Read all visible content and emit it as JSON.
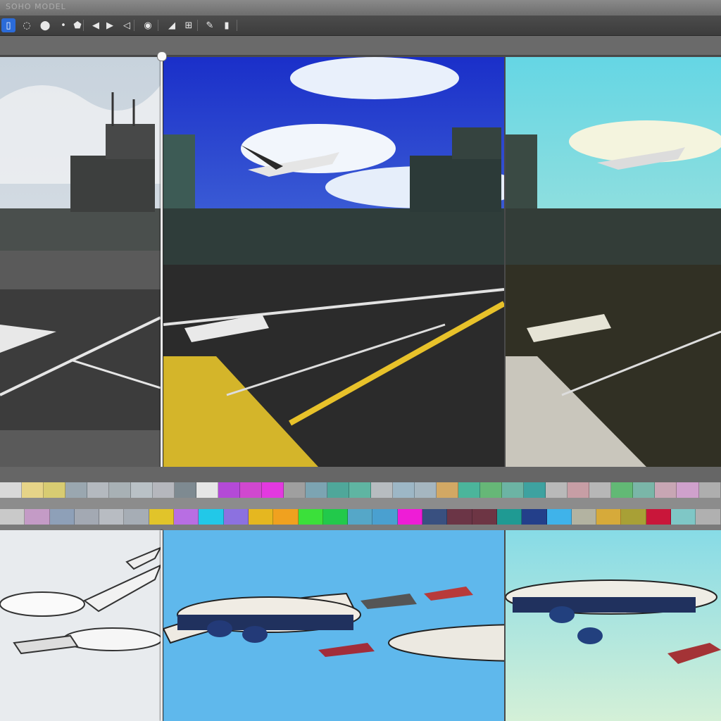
{
  "window": {
    "title": "SOHO MODEL"
  },
  "toolbar": {
    "tools": [
      {
        "name": "select-tool-icon",
        "glyph": "▯",
        "active": true
      },
      {
        "name": "lasso-tool-icon",
        "glyph": "◌",
        "active": false
      },
      {
        "name": "brush-tool-icon",
        "glyph": "⬤",
        "active": false
      },
      {
        "name": "dot-tool-icon",
        "glyph": "•",
        "active": false
      },
      {
        "name": "gem-tool-icon",
        "glyph": "⬟",
        "active": false
      },
      {
        "name": "arrow-left-icon",
        "glyph": "◀",
        "active": false
      },
      {
        "name": "arrow-right-icon",
        "glyph": "▶",
        "active": false
      },
      {
        "name": "undo-icon",
        "glyph": "◁",
        "active": false
      },
      {
        "name": "eye-icon",
        "glyph": "◉",
        "active": false
      },
      {
        "name": "shape-tool-icon",
        "glyph": "◢",
        "active": false
      },
      {
        "name": "crop-tool-icon",
        "glyph": "⊞",
        "active": false
      },
      {
        "name": "pen-tool-icon",
        "glyph": "✎",
        "active": false
      },
      {
        "name": "bucket-tool-icon",
        "glyph": "▮",
        "active": false
      }
    ]
  },
  "palettes": {
    "top": [
      "#d9d9d9",
      "#e6d488",
      "#d8cc72",
      "#9aa7b0",
      "#b4b9bf",
      "#a8b1b5",
      "#b9c1c6",
      "#b5b7bd",
      "#7e8a91",
      "#e6e6e6",
      "#b44ad7",
      "#d048cf",
      "#e339e0",
      "#9f9f9f",
      "#7ca4b2",
      "#4fa79a",
      "#5fb5a2",
      "#b7bcc0",
      "#9db7c6",
      "#a5b6c0",
      "#d2a864",
      "#4bb59b",
      "#66b777",
      "#6cb4a4",
      "#3ea2a0",
      "#b9b9b9",
      "#c79ea5",
      "#b7b7b7",
      "#62b975",
      "#7ab6a8",
      "#c8a6b4",
      "#cfa1cc",
      "#aeaeae"
    ],
    "bottom": [
      "#c9c9c9",
      "#c49bc6",
      "#8ea0b8",
      "#a3a9b3",
      "#b8bcc2",
      "#a6adb5",
      "#e1c42a",
      "#b86ee3",
      "#22c8e8",
      "#8c71e0",
      "#e5b720",
      "#f0a11f",
      "#3be03a",
      "#22c94b",
      "#55a7c8",
      "#4aa0d0",
      "#ee1dd6",
      "#395080",
      "#6b3546",
      "#6d3544",
      "#1f9a93",
      "#233f8a",
      "#3fb3ea",
      "#b3b3a1",
      "#d6aa3a",
      "#a8a036",
      "#c9163a",
      "#7fc7c6",
      "#b0b0b0"
    ]
  },
  "panels": {
    "top_labels": [],
    "bottom_labels": []
  }
}
